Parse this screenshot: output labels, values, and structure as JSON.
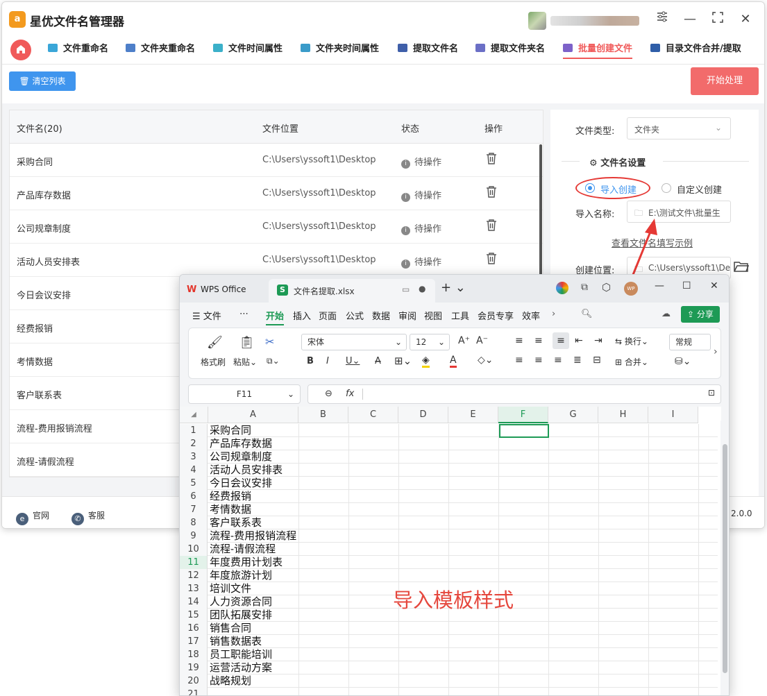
{
  "app": {
    "title": "星优文件名管理器",
    "logo_text": "a",
    "tabs": [
      "文件重命名",
      "文件夹重命名",
      "文件时间属性",
      "文件夹时间属性",
      "提取文件名",
      "提取文件夹名",
      "批量创建文件",
      "目录文件合并/提取"
    ],
    "active_tab": "批量创建文件",
    "clear_button": "清空列表",
    "start_button": "开始处理"
  },
  "table": {
    "headers": {
      "name": "文件名(20)",
      "location": "文件位置",
      "status": "状态",
      "action": "操作"
    },
    "rows": [
      {
        "name": "采购合同",
        "location": "C:\\Users\\yssoft1\\Desktop",
        "status": "待操作"
      },
      {
        "name": "产品库存数据",
        "location": "C:\\Users\\yssoft1\\Desktop",
        "status": "待操作"
      },
      {
        "name": "公司规章制度",
        "location": "C:\\Users\\yssoft1\\Desktop",
        "status": "待操作"
      },
      {
        "name": "活动人员安排表",
        "location": "C:\\Users\\yssoft1\\Desktop",
        "status": "待操作"
      },
      {
        "name": "今日会议安排"
      },
      {
        "name": "经费报销"
      },
      {
        "name": "考情数据"
      },
      {
        "name": "客户联系表"
      },
      {
        "name": "流程-费用报销流程"
      },
      {
        "name": "流程-请假流程"
      }
    ]
  },
  "settings": {
    "file_type_label": "文件类型:",
    "file_type_value": "文件夹",
    "section_title": "文件名设置",
    "radio_import": "导入创建",
    "radio_custom": "自定义创建",
    "import_name_label": "导入名称:",
    "import_name_value": "E:\\测试文件\\批量生",
    "example_link": "查看文件名填写示例",
    "create_location_label": "创建位置:",
    "create_location_value": "C:\\Users\\yssoft1\\De"
  },
  "footer": {
    "website": "官网",
    "service": "客服",
    "version": "2.0.0"
  },
  "wps": {
    "app_tab": "WPS Office",
    "file_tab": "文件名提取.xlsx",
    "avatar_text": "WP",
    "menus": [
      "文件",
      "⋯",
      "开始",
      "插入",
      "页面",
      "公式",
      "数据",
      "审阅",
      "视图",
      "工具",
      "会员专享",
      "效率"
    ],
    "active_menu": "开始",
    "share": "分享",
    "ribbon": {
      "format_painter": "格式刷",
      "paste": "粘贴",
      "font": "宋体",
      "size": "12",
      "wrap": "换行",
      "merge": "合并",
      "number_format": "常规"
    },
    "name_box": "F11",
    "fx": "fx",
    "columns": [
      "A",
      "B",
      "C",
      "D",
      "E",
      "F",
      "G",
      "H",
      "I"
    ],
    "selected_column": "F",
    "selected_row": 11,
    "cells": [
      "采购合同",
      "产品库存数据",
      "公司规章制度",
      "活动人员安排表",
      "今日会议安排",
      "经费报销",
      "考情数据",
      "客户联系表",
      "流程-费用报销流程",
      "流程-请假流程",
      "年度费用计划表",
      "年度旅游计划",
      "培训文件",
      "人力资源合同",
      "团队拓展安排",
      "销售合同",
      "销售数据表",
      "员工职能培训",
      "运营活动方案",
      "战略规划"
    ],
    "last_row_number": "21"
  },
  "annotation": "导入模板样式",
  "colors": {
    "accent_red": "#f05a5a",
    "primary_blue": "#3f95ee",
    "wps_green": "#1d9a55",
    "annotation_red": "#e5473d"
  }
}
